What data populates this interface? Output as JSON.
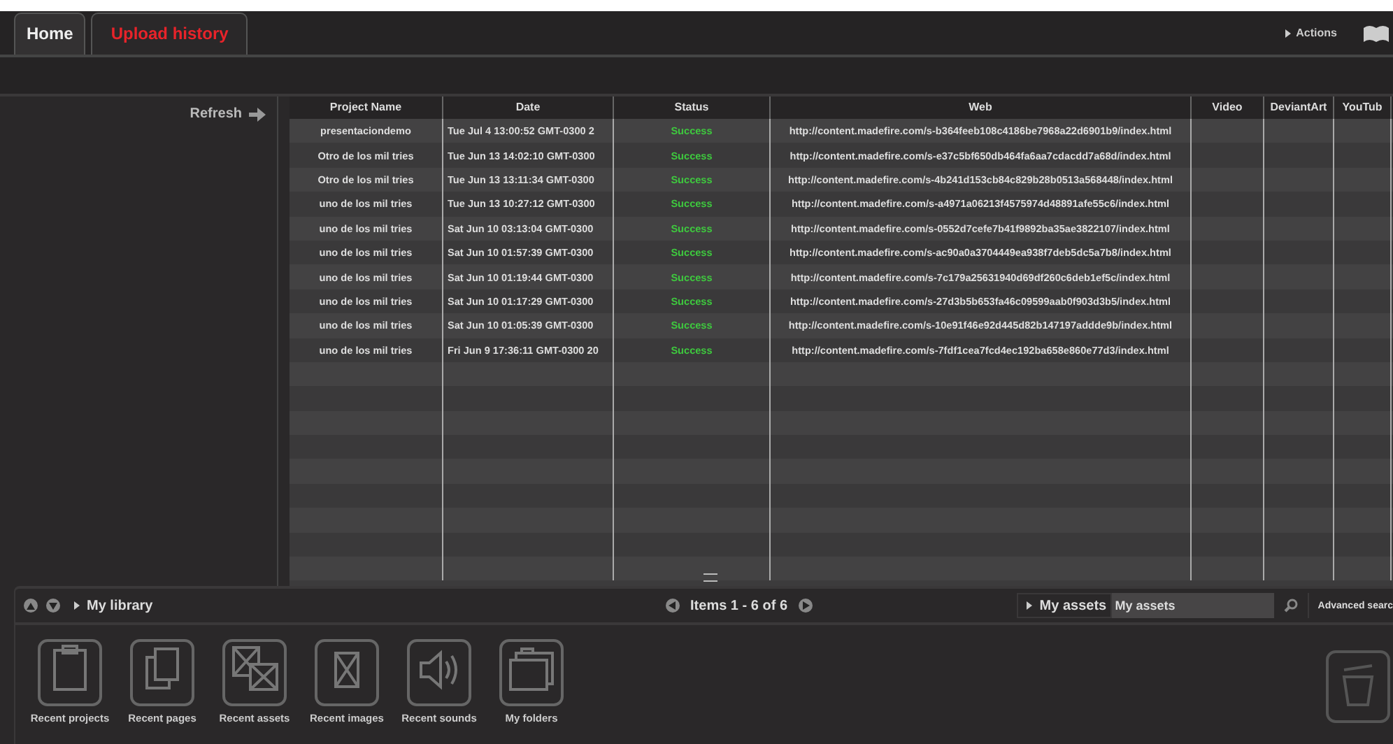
{
  "tabs": [
    {
      "label": "Home",
      "selected": false
    },
    {
      "label": "Upload history",
      "selected": true
    }
  ],
  "actions": {
    "label": "Actions"
  },
  "refresh": {
    "label": "Refresh"
  },
  "table": {
    "columns": [
      "Project Name",
      "Date",
      "Status",
      "Web",
      "Video",
      "DeviantArt",
      "YouTub"
    ],
    "rows": [
      {
        "project": "presentaciondemo",
        "date": "Tue Jul 4 13:00:52 GMT-0300 2",
        "status": "Success",
        "web": "http://content.madefire.com/s-b364feeb108c4186be7968a22d6901b9/index.html"
      },
      {
        "project": "Otro de los mil tries",
        "date": "Tue Jun 13 14:02:10 GMT-0300",
        "status": "Success",
        "web": "http://content.madefire.com/s-e37c5bf650db464fa6aa7cdacdd7a68d/index.html"
      },
      {
        "project": "Otro de los mil tries",
        "date": "Tue Jun 13 13:11:34 GMT-0300",
        "status": "Success",
        "web": "http://content.madefire.com/s-4b241d153cb84c829b28b0513a568448/index.html"
      },
      {
        "project": "uno de los mil tries",
        "date": "Tue Jun 13 10:27:12 GMT-0300",
        "status": "Success",
        "web": "http://content.madefire.com/s-a4971a06213f4575974d48891afe55c6/index.html"
      },
      {
        "project": "uno de los mil tries",
        "date": "Sat Jun 10 03:13:04 GMT-0300",
        "status": "Success",
        "web": "http://content.madefire.com/s-0552d7cefe7b41f9892ba35ae3822107/index.html"
      },
      {
        "project": "uno de los mil tries",
        "date": "Sat Jun 10 01:57:39 GMT-0300",
        "status": "Success",
        "web": "http://content.madefire.com/s-ac90a0a3704449ea938f7deb5dc5a7b8/index.html"
      },
      {
        "project": "uno de los mil tries",
        "date": "Sat Jun 10 01:19:44 GMT-0300",
        "status": "Success",
        "web": "http://content.madefire.com/s-7c179a25631940d69df260c6deb1ef5c/index.html"
      },
      {
        "project": "uno de los mil tries",
        "date": "Sat Jun 10 01:17:29 GMT-0300",
        "status": "Success",
        "web": "http://content.madefire.com/s-27d3b5b653fa46c09599aab0f903d3b5/index.html"
      },
      {
        "project": "uno de los mil tries",
        "date": "Sat Jun 10 01:05:39 GMT-0300",
        "status": "Success",
        "web": "http://content.madefire.com/s-10e91f46e92d445d82b147197addde9b/index.html"
      },
      {
        "project": "uno de los mil tries",
        "date": "Fri Jun 9 17:36:11 GMT-0300 20",
        "status": "Success",
        "web": "http://content.madefire.com/s-7fdf1cea7fcd4ec192ba658e860e77d3/index.html"
      }
    ]
  },
  "library": {
    "title": "My library",
    "pager": "Items 1 - 6 of 6",
    "assets_menu": "My assets",
    "search": {
      "value": "My assets"
    },
    "advanced": "Advanced searc",
    "items": [
      {
        "kind": "clipboard",
        "label": "Recent projects"
      },
      {
        "kind": "pages",
        "label": "Recent pages"
      },
      {
        "kind": "assets",
        "label": "Recent assets"
      },
      {
        "kind": "image",
        "label": "Recent images"
      },
      {
        "kind": "sound",
        "label": "Recent sounds"
      },
      {
        "kind": "folders",
        "label": "My folders"
      }
    ]
  }
}
